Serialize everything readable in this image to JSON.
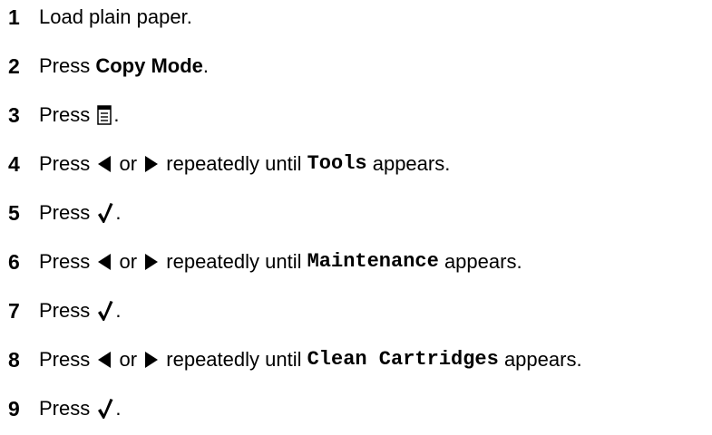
{
  "steps": [
    {
      "number": "1",
      "segments": [
        {
          "type": "text",
          "text": "Load plain paper."
        }
      ]
    },
    {
      "number": "2",
      "segments": [
        {
          "type": "text",
          "text": "Press "
        },
        {
          "type": "bold",
          "text": "Copy Mode"
        },
        {
          "type": "text",
          "text": "."
        }
      ]
    },
    {
      "number": "3",
      "segments": [
        {
          "type": "text",
          "text": "Press "
        },
        {
          "type": "icon",
          "icon": "menu-icon"
        },
        {
          "type": "text",
          "text": "."
        }
      ]
    },
    {
      "number": "4",
      "segments": [
        {
          "type": "text",
          "text": "Press "
        },
        {
          "type": "icon",
          "icon": "left-arrow-icon"
        },
        {
          "type": "text",
          "text": " or "
        },
        {
          "type": "icon",
          "icon": "right-arrow-icon"
        },
        {
          "type": "text",
          "text": " repeatedly until "
        },
        {
          "type": "mono",
          "text": "Tools"
        },
        {
          "type": "text",
          "text": " appears."
        }
      ]
    },
    {
      "number": "5",
      "segments": [
        {
          "type": "text",
          "text": "Press "
        },
        {
          "type": "icon",
          "icon": "checkmark-icon"
        },
        {
          "type": "text",
          "text": "."
        }
      ]
    },
    {
      "number": "6",
      "segments": [
        {
          "type": "text",
          "text": "Press "
        },
        {
          "type": "icon",
          "icon": "left-arrow-icon"
        },
        {
          "type": "text",
          "text": " or "
        },
        {
          "type": "icon",
          "icon": "right-arrow-icon"
        },
        {
          "type": "text",
          "text": " repeatedly until "
        },
        {
          "type": "mono",
          "text": "Maintenance"
        },
        {
          "type": "text",
          "text": " appears."
        }
      ]
    },
    {
      "number": "7",
      "segments": [
        {
          "type": "text",
          "text": "Press "
        },
        {
          "type": "icon",
          "icon": "checkmark-icon"
        },
        {
          "type": "text",
          "text": "."
        }
      ]
    },
    {
      "number": "8",
      "segments": [
        {
          "type": "text",
          "text": "Press "
        },
        {
          "type": "icon",
          "icon": "left-arrow-icon"
        },
        {
          "type": "text",
          "text": " or "
        },
        {
          "type": "icon",
          "icon": "right-arrow-icon"
        },
        {
          "type": "text",
          "text": " repeatedly until "
        },
        {
          "type": "mono",
          "text": "Clean Cartridges"
        },
        {
          "type": "text",
          "text": " appears."
        }
      ]
    },
    {
      "number": "9",
      "segments": [
        {
          "type": "text",
          "text": "Press "
        },
        {
          "type": "icon",
          "icon": "checkmark-icon"
        },
        {
          "type": "text",
          "text": "."
        }
      ]
    }
  ]
}
